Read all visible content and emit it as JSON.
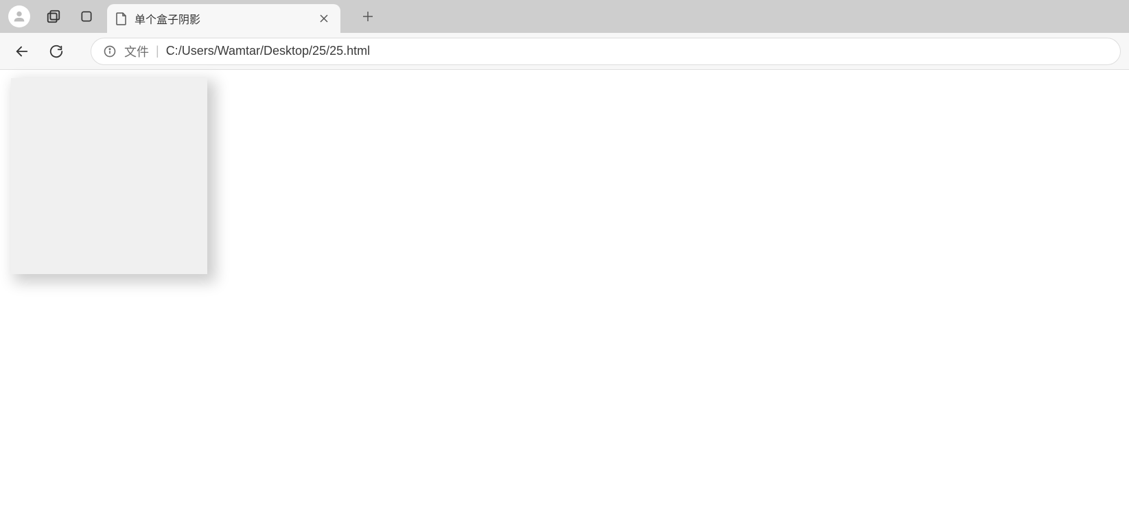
{
  "tab": {
    "title": "单个盒子阴影"
  },
  "address": {
    "protocol_label": "文件",
    "separator": "|",
    "url": "C:/Users/Wamtar/Desktop/25/25.html"
  }
}
